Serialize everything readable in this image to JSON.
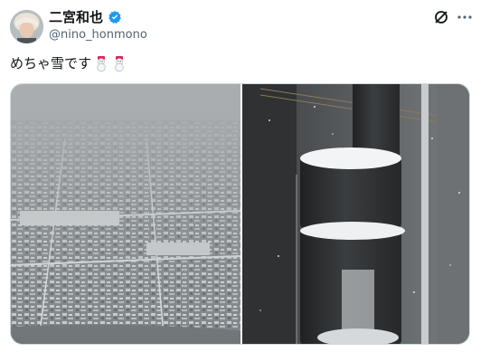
{
  "post": {
    "display_name": "二宮和也",
    "handle": "@nino_honmono",
    "text": "めちゃ雪です",
    "emoji": [
      "snowman-emoji",
      "snowman-emoji"
    ]
  },
  "icons": {
    "verified": "verified-badge-icon",
    "grok": "grok-icon",
    "more": "more-icon"
  },
  "colors": {
    "verified_blue": "#1d9bf0",
    "handle_gray": "#536471",
    "border": "#cfd9de"
  },
  "media": {
    "images": [
      "snowy-city-aerial-photo",
      "snowy-pillar-photo"
    ]
  }
}
